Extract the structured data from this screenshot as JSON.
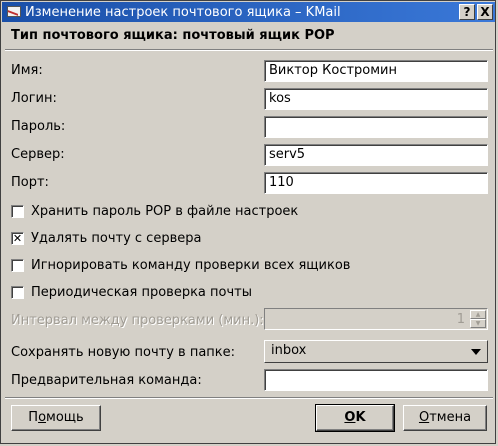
{
  "window": {
    "title": "Изменение настроек почтового ящика – KMail",
    "help_glyph": "?",
    "close_glyph": "X"
  },
  "header": "Тип почтового ящика: почтовый ящик POP",
  "fields": {
    "name_label": "Имя:",
    "name_value": "Виктор Костромин",
    "login_label": "Логин:",
    "login_value": "kos",
    "password_label": "Пароль:",
    "password_value": "",
    "server_label": "Сервер:",
    "server_value": "serv5",
    "port_label": "Порт:",
    "port_value": "110"
  },
  "checkboxes": [
    {
      "label": "Хранить пароль POP в файле настроек",
      "checked": false
    },
    {
      "label": "Удалять почту с сервера",
      "checked": true
    },
    {
      "label": "Игнорировать команду проверки всех ящиков",
      "checked": false
    },
    {
      "label": "Периодическая проверка почты",
      "checked": false
    }
  ],
  "interval": {
    "label": "Интервал между проверками (мин.):",
    "value": "1"
  },
  "folder": {
    "label": "Сохранять новую почту в папке:",
    "selected": "inbox"
  },
  "precommand": {
    "label": "Предварительная команда:",
    "value": ""
  },
  "buttons": {
    "help": {
      "pre": "П",
      "ul": "о",
      "post": "мощь"
    },
    "ok": {
      "pre": "",
      "ul": "O",
      "post": "K"
    },
    "cancel": {
      "pre": "",
      "ul": "О",
      "post": "тмена"
    }
  }
}
